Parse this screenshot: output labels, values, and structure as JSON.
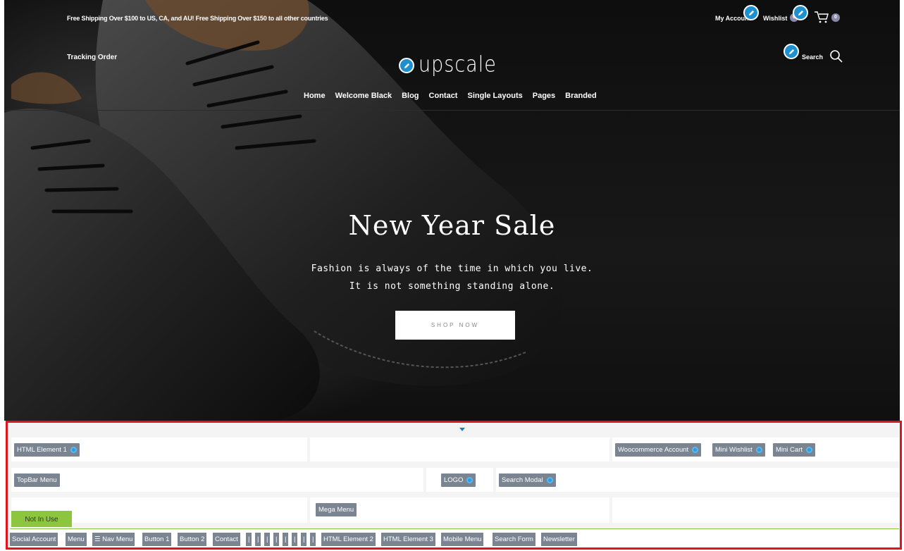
{
  "topbar": {
    "shipping_text": "Free Shipping Over $100 to US, CA, and AU! Free Shipping Over $150 to all other countries",
    "my_account": "My Account",
    "wishlist": "Wishlist",
    "cart_count": "0",
    "wishlist_count": "0"
  },
  "header": {
    "tracking": "Tracking Order",
    "logo": "upscale",
    "search": "Search"
  },
  "nav": {
    "items": [
      "Home",
      "Welcome Black",
      "Blog",
      "Contact",
      "Single Layouts",
      "Pages",
      "Branded"
    ]
  },
  "hero": {
    "title": "New Year Sale",
    "line1": "Fashion is always of the time in which you live.",
    "line2": "It is not something standing alone.",
    "button": "SHOP NOW"
  },
  "builder": {
    "row1": {
      "left": "HTML Element 1",
      "right": [
        "Woocommerce Account",
        "Mini Wishlist",
        "Mini Cart"
      ]
    },
    "row2": {
      "left": "TopBar Menu",
      "logo": "LOGO",
      "search": "Search Modal"
    },
    "row3": {
      "mega": "Mega Menu"
    },
    "not_in_use": "Not In Use",
    "unused": [
      "Social Account",
      "Menu",
      "☰ Nav Menu",
      "Button 1",
      "Button 2",
      "Contact",
      "|",
      "|",
      "|",
      "|",
      "|",
      "|",
      "|",
      "|",
      "HTML Element 2",
      "HTML Element 3",
      "Mobile Menu",
      "Search Form",
      "Newsletter"
    ]
  },
  "colors": {
    "builder_border": "#e0151b",
    "chip": "#7b8591",
    "edit_pencil": "#1e8fcf",
    "not_in_use": "#8cc63f"
  }
}
